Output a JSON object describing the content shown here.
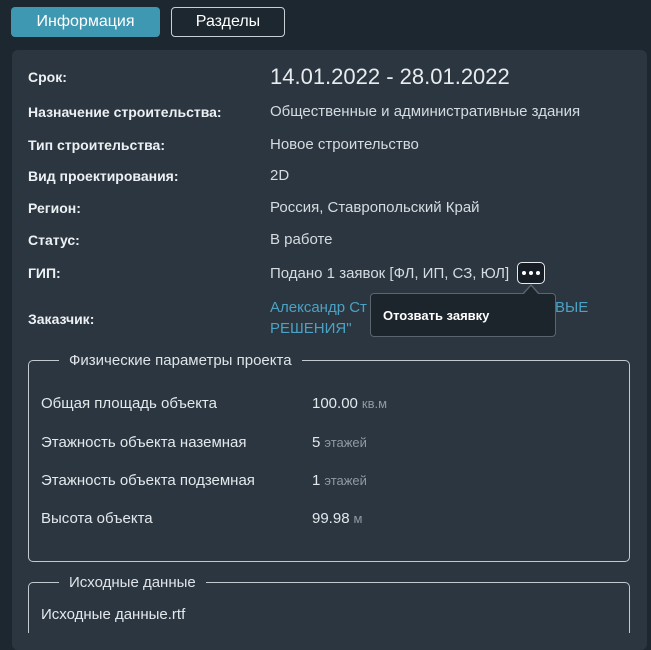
{
  "tabs": {
    "info": "Информация",
    "sections": "Разделы"
  },
  "details": {
    "term": {
      "label": "Срок:",
      "value": "14.01.2022 - 28.01.2022"
    },
    "purpose": {
      "label": "Назначение строительства:",
      "value": "Общественные и административные здания"
    },
    "type": {
      "label": "Тип строительства:",
      "value": "Новое строительство"
    },
    "design": {
      "label": "Вид проектирования:",
      "value": "2D"
    },
    "region": {
      "label": "Регион:",
      "value": "Россия, Ставропольский Край"
    },
    "status": {
      "label": "Статус:",
      "value": "В работе"
    },
    "gip": {
      "label": "ГИП:",
      "value": "Подано 1 заявок [ФЛ, ИП, СЗ, ЮЛ]"
    },
    "customer": {
      "label": "Заказчик:",
      "line1_left": "Александр Ст",
      "line1_right": "ВЫЕ",
      "line2": "РЕШЕНИЯ\""
    }
  },
  "popup": {
    "revoke": "Отозвать заявку"
  },
  "physical": {
    "title": "Физические параметры проекта",
    "rows": [
      {
        "label": "Общая площадь объекта",
        "value": "100.00",
        "unit": "кв.м"
      },
      {
        "label": "Этажность объекта наземная",
        "value": "5",
        "unit": "этажей"
      },
      {
        "label": "Этажность объекта подземная",
        "value": "1",
        "unit": "этажей"
      },
      {
        "label": "Высота объекта",
        "value": "99.98",
        "unit": "м"
      }
    ]
  },
  "source": {
    "title": "Исходные данные",
    "file": "Исходные данные.rtf"
  }
}
